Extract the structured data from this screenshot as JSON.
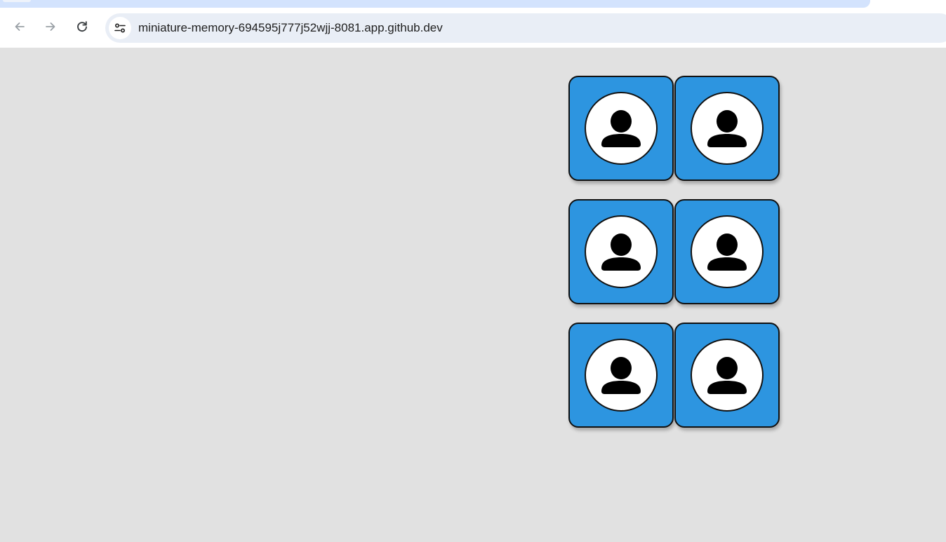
{
  "browser": {
    "url": "miniature-memory-694595j777j52wjj-8081.app.github.dev",
    "nav": {
      "back_icon": "arrow-left-icon",
      "forward_icon": "arrow-right-icon",
      "reload_icon": "reload-icon",
      "site_info_icon": "tune-icon"
    }
  },
  "game": {
    "card_icon": "person-icon",
    "colors": {
      "background": "#e1e1e1",
      "card_back": "#2d95e0",
      "card_border": "#111111"
    },
    "cards": [
      {
        "row": 1,
        "col": 1,
        "state": "face-down"
      },
      {
        "row": 1,
        "col": 2,
        "state": "face-down"
      },
      {
        "row": 2,
        "col": 1,
        "state": "face-down"
      },
      {
        "row": 2,
        "col": 2,
        "state": "face-down"
      },
      {
        "row": 3,
        "col": 1,
        "state": "face-down"
      },
      {
        "row": 3,
        "col": 2,
        "state": "face-down"
      }
    ]
  }
}
